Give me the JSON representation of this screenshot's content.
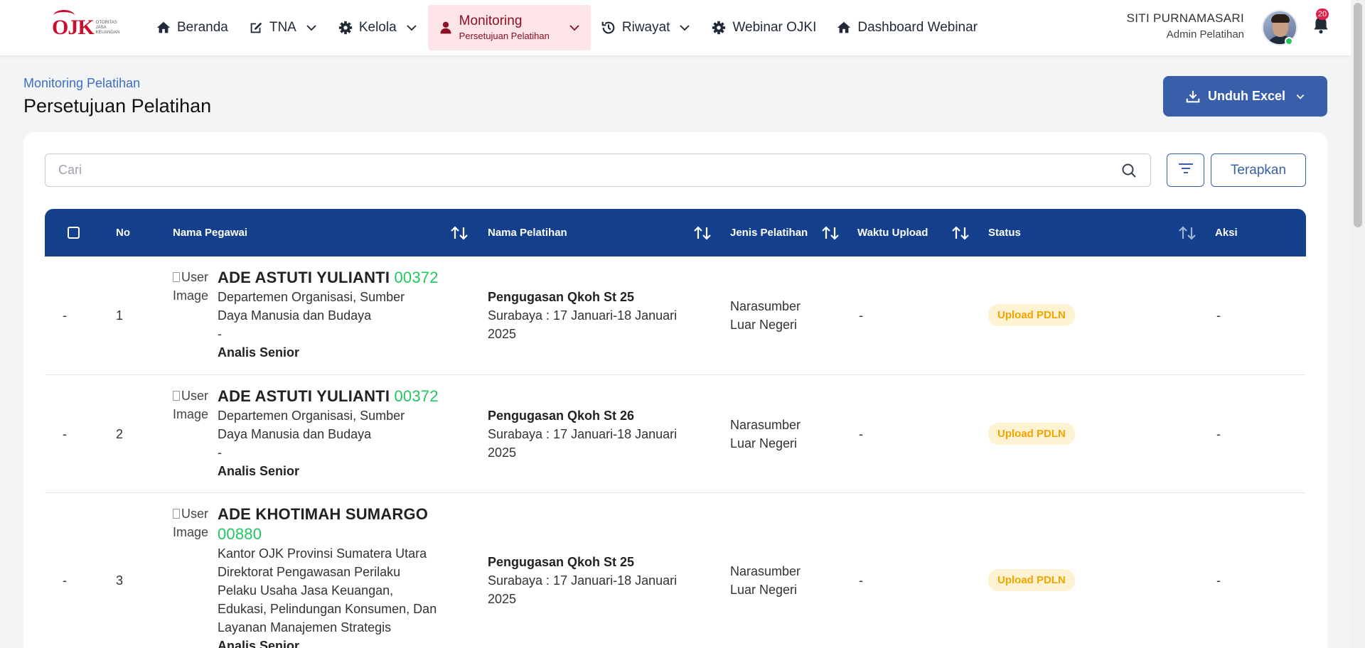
{
  "logo": {
    "mark": "OJK",
    "caption": "OTORITAS JASA KEUANGAN"
  },
  "nav": {
    "items": [
      {
        "label": "Beranda",
        "icon": "home-icon"
      },
      {
        "label": "TNA",
        "icon": "edit-icon"
      },
      {
        "label": "Kelola",
        "icon": "gear-icon"
      },
      {
        "label": "Monitoring",
        "sub": "Persetujuan Pelatihan",
        "icon": "person-icon",
        "active": true
      },
      {
        "label": "Riwayat",
        "icon": "history-icon"
      },
      {
        "label": "Webinar OJKI",
        "icon": "gear-icon"
      },
      {
        "label": "Dashboard Webinar",
        "icon": "home-icon"
      }
    ]
  },
  "user": {
    "name": "SITI PURNAMASARI",
    "role": "Admin Pelatihan",
    "notifications": "20"
  },
  "header": {
    "breadcrumb": "Monitoring Pelatihan",
    "title": "Persetujuan Pelatihan",
    "export_label": "Unduh Excel"
  },
  "filters": {
    "search_placeholder": "Cari",
    "search_value": "",
    "apply_label": "Terapkan"
  },
  "table": {
    "columns": [
      "No",
      "Nama Pegawai",
      "Nama Pelatihan",
      "Jenis Pelatihan",
      "Waktu Upload",
      "Status",
      "Aksi"
    ],
    "rows": [
      {
        "select": "-",
        "no": "1",
        "img_alt": "User Image",
        "name": "ADE ASTUTI YULIANTI",
        "nip": "00372",
        "dept_lines": [
          "Departemen Organisasi, Sumber",
          "Daya Manusia dan Budaya",
          "-"
        ],
        "jabatan": "Analis Senior",
        "pelatihan": "Pengugasan Qkoh St 25",
        "pelatihan_detail_lines": [
          "Surabaya : 17 Januari-18 Januari",
          "2025"
        ],
        "jenis_lines": [
          "Narasumber",
          "Luar Negeri"
        ],
        "waktu": "-",
        "status": "Upload PDLN",
        "aksi": "-"
      },
      {
        "select": "-",
        "no": "2",
        "img_alt": "User Image",
        "name": "ADE ASTUTI YULIANTI",
        "nip": "00372",
        "dept_lines": [
          "Departemen Organisasi, Sumber",
          "Daya Manusia dan Budaya",
          "-"
        ],
        "jabatan": "Analis Senior",
        "pelatihan": "Pengugasan Qkoh St 26",
        "pelatihan_detail_lines": [
          "Surabaya : 17 Januari-18 Januari",
          "2025"
        ],
        "jenis_lines": [
          "Narasumber",
          "Luar Negeri"
        ],
        "waktu": "-",
        "status": "Upload PDLN",
        "aksi": "-"
      },
      {
        "select": "-",
        "no": "3",
        "img_alt": "User Image",
        "name": "ADE KHOTIMAH SUMARGO",
        "nip": "00880",
        "dept_lines": [
          "Kantor OJK Provinsi Sumatera Utara",
          "Direktorat Pengawasan Perilaku",
          "Pelaku Usaha Jasa Keuangan,",
          "Edukasi, Pelindungan Konsumen, Dan",
          "Layanan Manajemen Strategis"
        ],
        "jabatan": "Analis Senior",
        "pelatihan": "Pengugasan Qkoh St 25",
        "pelatihan_detail_lines": [
          "Surabaya : 17 Januari-18 Januari",
          "2025"
        ],
        "jenis_lines": [
          "Narasumber",
          "Luar Negeri"
        ],
        "waktu": "-",
        "status": "Upload PDLN",
        "aksi": "-"
      }
    ]
  },
  "colors": {
    "primary": "#3a5faa",
    "header": "#143f8c",
    "active_nav": "#fde4e7",
    "nip": "#22c55e",
    "status_text": "#f0a500",
    "status_bg": "#fdf2d2"
  }
}
